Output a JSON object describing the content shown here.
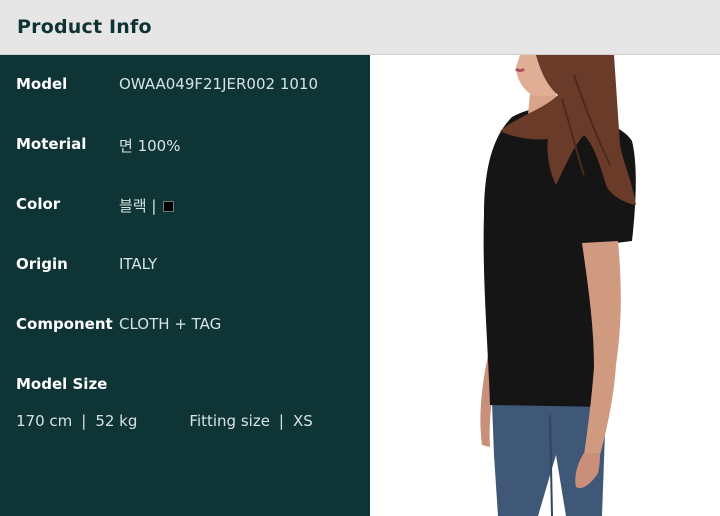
{
  "header": {
    "title": "Product Info"
  },
  "specs": [
    {
      "label": "Model",
      "value": "OWAA049F21JER002 1010"
    },
    {
      "label": "Moterial",
      "value": "면 100%"
    },
    {
      "label": "Color",
      "value": "블랙 |"
    },
    {
      "label": "Origin",
      "value": "ITALY"
    },
    {
      "label": "Component",
      "value": "CLOTH + TAG"
    }
  ],
  "color_swatch": "#000000",
  "model_size": {
    "label": "Model Size",
    "height": "170 cm",
    "sep": "|",
    "weight": "52 kg",
    "fitting_label": "Fitting size",
    "fitting_value": "XS"
  },
  "colors": {
    "panel_bg": "#0e3435",
    "header_bg": "#e6e6e6",
    "shirt": "#151515",
    "jeans": "#3f5878"
  }
}
